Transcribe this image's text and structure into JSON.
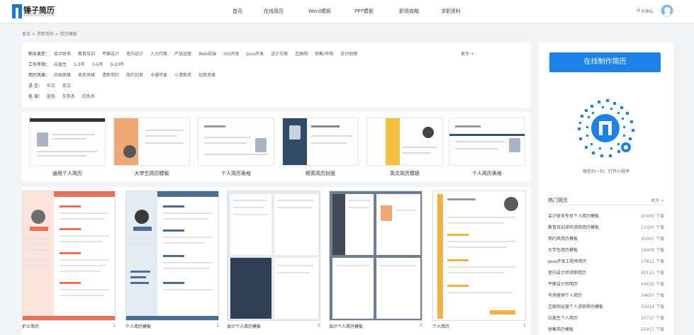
{
  "header": {
    "logo_name": "锤子简历",
    "logo_domain": "100CHUIZI.COM",
    "nav": [
      "首页",
      "在线简历",
      "Word模板",
      "PPT模板",
      "职场攻略",
      "求职资料"
    ],
    "user_label": "个人中心"
  },
  "breadcrumb": "首页 > 求职资料 > 简历模板",
  "filters": {
    "more_label": "更多 +",
    "rows": [
      {
        "label": "职业类型：",
        "items": [
          "会计财务",
          "教育培训",
          "平面设计",
          "室内设计",
          "人力行政",
          "产品运营",
          "Web前端",
          "iOS开发",
          "Java开发",
          "设计方案",
          "互联网",
          "销售/市场",
          "设计助理"
        ]
      },
      {
        "label": "工作年限：",
        "items": [
          "应届生",
          "1-3年",
          "3-5年",
          "5-10年"
        ]
      },
      {
        "label": "简历风格：",
        "items": [
          "中国风格",
          "商务风格",
          "清新简约",
          "简约创意",
          "卡通可爱",
          "小清新风",
          "创意风格"
        ]
      },
      {
        "label": "语    言：",
        "items": [
          "中文",
          "英文"
        ]
      },
      {
        "label": "色    调：",
        "items": [
          "蓝色",
          "灰色系",
          "红色系"
        ]
      }
    ]
  },
  "categories": [
    {
      "label": "通用个人简历"
    },
    {
      "label": "大学生简历模板"
    },
    {
      "label": "个人简历表格"
    },
    {
      "label": "精英简历封面"
    },
    {
      "label": "英文简历模板"
    },
    {
      "label": "个人简历表格"
    }
  ],
  "templates": [
    {
      "title": "护士简历",
      "count": "1"
    },
    {
      "title": "个人简历模板",
      "count": "1"
    },
    {
      "title": "会计个人简历模板",
      "count": "0"
    },
    {
      "title": "会计个人简历模板",
      "count": "0"
    },
    {
      "title": "个人简历",
      "count": "1"
    }
  ],
  "sidebar": {
    "make_button": "在线制作简历",
    "qr_caption": "微信扫一扫，打开小程序",
    "hot_title": "热门简历",
    "hot_more": "更多 >",
    "hot_items": [
      {
        "name": "会计财务专员个人简历模板",
        "count": "20499 下载"
      },
      {
        "name": "教育培训讲师求职简历模板",
        "count": "21420 下载"
      },
      {
        "name": "简约风简历模板",
        "count": "20461 下载"
      },
      {
        "name": "大学生简历模板",
        "count": "19408 下载"
      },
      {
        "name": "Java开发工程师简历",
        "count": "17812 下载"
      },
      {
        "name": "室内设计师求职简历",
        "count": "49115 下载"
      },
      {
        "name": "平面设计师简历",
        "count": "44632 下载"
      },
      {
        "name": "市场营销个人简历",
        "count": "34650 下载"
      },
      {
        "name": "互联网运营个人求职简历模板",
        "count": "32014 下载"
      },
      {
        "name": "应届生个人简历",
        "count": "25737 下载"
      },
      {
        "name": "销售简历模板",
        "count": "25417 下载"
      }
    ]
  },
  "colors": {
    "accent": "#1c82e8",
    "brand": "#1677d2"
  }
}
